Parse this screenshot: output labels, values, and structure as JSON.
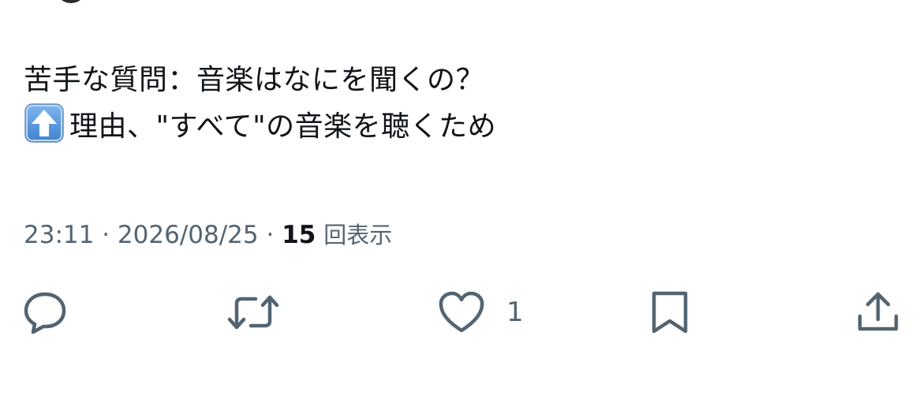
{
  "tweet": {
    "line1": "苦手な質問：音楽はなにを聞くの？",
    "line2_emoji": "up-arrow-emoji",
    "line2": "理由、\"すべて\"の音楽を聴くため"
  },
  "meta": {
    "time": "23:11",
    "separator": "·",
    "date": "2026/08/25",
    "views_count": "15",
    "views_label": "回表示"
  },
  "actions": {
    "reply_icon": "reply-icon",
    "retweet_icon": "retweet-icon",
    "like_icon": "heart-icon",
    "like_count": "1",
    "bookmark_icon": "bookmark-icon",
    "share_icon": "share-icon"
  },
  "colors": {
    "text": "#0f1419",
    "secondary": "#536471",
    "emoji_blue": "#4a90d9"
  }
}
